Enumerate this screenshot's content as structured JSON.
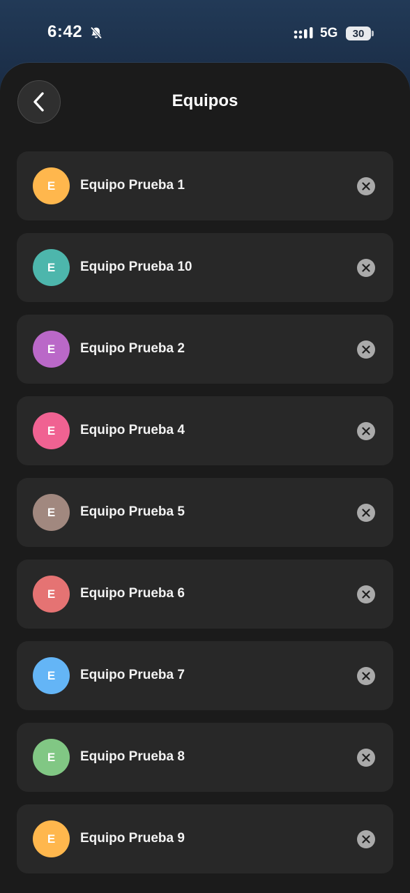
{
  "status": {
    "time": "6:42",
    "network": "5G",
    "battery": "30"
  },
  "header": {
    "title": "Equipos"
  },
  "teams": [
    {
      "initial": "E",
      "name": "Equipo Prueba 1",
      "color": "#FFB74D"
    },
    {
      "initial": "E",
      "name": "Equipo Prueba 10",
      "color": "#4DB6AC"
    },
    {
      "initial": "E",
      "name": "Equipo Prueba 2",
      "color": "#BA68C8"
    },
    {
      "initial": "E",
      "name": "Equipo Prueba 4",
      "color": "#F06292"
    },
    {
      "initial": "E",
      "name": "Equipo Prueba 5",
      "color": "#A1887F"
    },
    {
      "initial": "E",
      "name": "Equipo Prueba 6",
      "color": "#E57373"
    },
    {
      "initial": "E",
      "name": "Equipo Prueba 7",
      "color": "#64B5F6"
    },
    {
      "initial": "E",
      "name": "Equipo Prueba 8",
      "color": "#81C784"
    },
    {
      "initial": "E",
      "name": "Equipo Prueba 9",
      "color": "#FFB74D"
    }
  ],
  "icons": {
    "back": "chevron-left-icon",
    "remove": "close-circle-icon",
    "bell": "bell-slash-icon",
    "signal": "signal-icon"
  }
}
